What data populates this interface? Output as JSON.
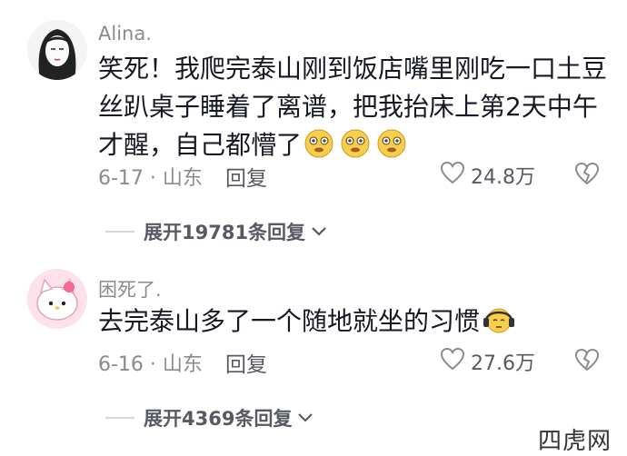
{
  "comments": [
    {
      "username": "Alina.",
      "text_line1": "笑死！我爬完泰山刚到饭店嘴里刚吃一口土豆",
      "text_line2": "丝趴桌子睡着了离谱，把我抬床上第2天中午",
      "text_line3": "才醒，自己都懵了",
      "emoji": "dizzy-face-emoji",
      "date_location": "6-17 · 山东",
      "reply_label": "回复",
      "likes": "24.8万",
      "expand_label": "展开19781条回复"
    },
    {
      "username": "困死了.",
      "text_line1": "去完泰山多了一个随地就坐的习惯",
      "emoji": "sleepy-headphones-emoji",
      "date_location": "6-16 · 山东",
      "reply_label": "回复",
      "likes": "27.6万",
      "expand_label": "展开4369条回复"
    }
  ],
  "watermark": "四虎网",
  "colors": {
    "text": "#161823",
    "secondary": "#8a8b91",
    "action": "#585a63"
  }
}
